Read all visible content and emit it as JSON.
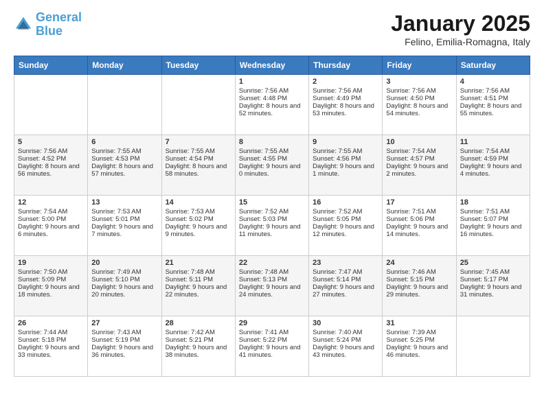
{
  "header": {
    "logo_line1": "General",
    "logo_line2": "Blue",
    "month": "January 2025",
    "location": "Felino, Emilia-Romagna, Italy"
  },
  "weekdays": [
    "Sunday",
    "Monday",
    "Tuesday",
    "Wednesday",
    "Thursday",
    "Friday",
    "Saturday"
  ],
  "weeks": [
    [
      {
        "day": "",
        "sunrise": "",
        "sunset": "",
        "daylight": ""
      },
      {
        "day": "",
        "sunrise": "",
        "sunset": "",
        "daylight": ""
      },
      {
        "day": "",
        "sunrise": "",
        "sunset": "",
        "daylight": ""
      },
      {
        "day": "1",
        "sunrise": "Sunrise: 7:56 AM",
        "sunset": "Sunset: 4:48 PM",
        "daylight": "Daylight: 8 hours and 52 minutes."
      },
      {
        "day": "2",
        "sunrise": "Sunrise: 7:56 AM",
        "sunset": "Sunset: 4:49 PM",
        "daylight": "Daylight: 8 hours and 53 minutes."
      },
      {
        "day": "3",
        "sunrise": "Sunrise: 7:56 AM",
        "sunset": "Sunset: 4:50 PM",
        "daylight": "Daylight: 8 hours and 54 minutes."
      },
      {
        "day": "4",
        "sunrise": "Sunrise: 7:56 AM",
        "sunset": "Sunset: 4:51 PM",
        "daylight": "Daylight: 8 hours and 55 minutes."
      }
    ],
    [
      {
        "day": "5",
        "sunrise": "Sunrise: 7:56 AM",
        "sunset": "Sunset: 4:52 PM",
        "daylight": "Daylight: 8 hours and 56 minutes."
      },
      {
        "day": "6",
        "sunrise": "Sunrise: 7:55 AM",
        "sunset": "Sunset: 4:53 PM",
        "daylight": "Daylight: 8 hours and 57 minutes."
      },
      {
        "day": "7",
        "sunrise": "Sunrise: 7:55 AM",
        "sunset": "Sunset: 4:54 PM",
        "daylight": "Daylight: 8 hours and 58 minutes."
      },
      {
        "day": "8",
        "sunrise": "Sunrise: 7:55 AM",
        "sunset": "Sunset: 4:55 PM",
        "daylight": "Daylight: 9 hours and 0 minutes."
      },
      {
        "day": "9",
        "sunrise": "Sunrise: 7:55 AM",
        "sunset": "Sunset: 4:56 PM",
        "daylight": "Daylight: 9 hours and 1 minute."
      },
      {
        "day": "10",
        "sunrise": "Sunrise: 7:54 AM",
        "sunset": "Sunset: 4:57 PM",
        "daylight": "Daylight: 9 hours and 2 minutes."
      },
      {
        "day": "11",
        "sunrise": "Sunrise: 7:54 AM",
        "sunset": "Sunset: 4:59 PM",
        "daylight": "Daylight: 9 hours and 4 minutes."
      }
    ],
    [
      {
        "day": "12",
        "sunrise": "Sunrise: 7:54 AM",
        "sunset": "Sunset: 5:00 PM",
        "daylight": "Daylight: 9 hours and 6 minutes."
      },
      {
        "day": "13",
        "sunrise": "Sunrise: 7:53 AM",
        "sunset": "Sunset: 5:01 PM",
        "daylight": "Daylight: 9 hours and 7 minutes."
      },
      {
        "day": "14",
        "sunrise": "Sunrise: 7:53 AM",
        "sunset": "Sunset: 5:02 PM",
        "daylight": "Daylight: 9 hours and 9 minutes."
      },
      {
        "day": "15",
        "sunrise": "Sunrise: 7:52 AM",
        "sunset": "Sunset: 5:03 PM",
        "daylight": "Daylight: 9 hours and 11 minutes."
      },
      {
        "day": "16",
        "sunrise": "Sunrise: 7:52 AM",
        "sunset": "Sunset: 5:05 PM",
        "daylight": "Daylight: 9 hours and 12 minutes."
      },
      {
        "day": "17",
        "sunrise": "Sunrise: 7:51 AM",
        "sunset": "Sunset: 5:06 PM",
        "daylight": "Daylight: 9 hours and 14 minutes."
      },
      {
        "day": "18",
        "sunrise": "Sunrise: 7:51 AM",
        "sunset": "Sunset: 5:07 PM",
        "daylight": "Daylight: 9 hours and 16 minutes."
      }
    ],
    [
      {
        "day": "19",
        "sunrise": "Sunrise: 7:50 AM",
        "sunset": "Sunset: 5:09 PM",
        "daylight": "Daylight: 9 hours and 18 minutes."
      },
      {
        "day": "20",
        "sunrise": "Sunrise: 7:49 AM",
        "sunset": "Sunset: 5:10 PM",
        "daylight": "Daylight: 9 hours and 20 minutes."
      },
      {
        "day": "21",
        "sunrise": "Sunrise: 7:48 AM",
        "sunset": "Sunset: 5:11 PM",
        "daylight": "Daylight: 9 hours and 22 minutes."
      },
      {
        "day": "22",
        "sunrise": "Sunrise: 7:48 AM",
        "sunset": "Sunset: 5:13 PM",
        "daylight": "Daylight: 9 hours and 24 minutes."
      },
      {
        "day": "23",
        "sunrise": "Sunrise: 7:47 AM",
        "sunset": "Sunset: 5:14 PM",
        "daylight": "Daylight: 9 hours and 27 minutes."
      },
      {
        "day": "24",
        "sunrise": "Sunrise: 7:46 AM",
        "sunset": "Sunset: 5:15 PM",
        "daylight": "Daylight: 9 hours and 29 minutes."
      },
      {
        "day": "25",
        "sunrise": "Sunrise: 7:45 AM",
        "sunset": "Sunset: 5:17 PM",
        "daylight": "Daylight: 9 hours and 31 minutes."
      }
    ],
    [
      {
        "day": "26",
        "sunrise": "Sunrise: 7:44 AM",
        "sunset": "Sunset: 5:18 PM",
        "daylight": "Daylight: 9 hours and 33 minutes."
      },
      {
        "day": "27",
        "sunrise": "Sunrise: 7:43 AM",
        "sunset": "Sunset: 5:19 PM",
        "daylight": "Daylight: 9 hours and 36 minutes."
      },
      {
        "day": "28",
        "sunrise": "Sunrise: 7:42 AM",
        "sunset": "Sunset: 5:21 PM",
        "daylight": "Daylight: 9 hours and 38 minutes."
      },
      {
        "day": "29",
        "sunrise": "Sunrise: 7:41 AM",
        "sunset": "Sunset: 5:22 PM",
        "daylight": "Daylight: 9 hours and 41 minutes."
      },
      {
        "day": "30",
        "sunrise": "Sunrise: 7:40 AM",
        "sunset": "Sunset: 5:24 PM",
        "daylight": "Daylight: 9 hours and 43 minutes."
      },
      {
        "day": "31",
        "sunrise": "Sunrise: 7:39 AM",
        "sunset": "Sunset: 5:25 PM",
        "daylight": "Daylight: 9 hours and 46 minutes."
      },
      {
        "day": "",
        "sunrise": "",
        "sunset": "",
        "daylight": ""
      }
    ]
  ]
}
